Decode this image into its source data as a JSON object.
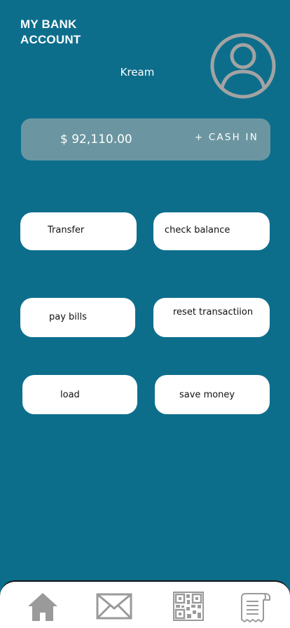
{
  "header": {
    "title": "MY BANK ACCOUNT",
    "user_name": "Kream"
  },
  "balance": {
    "amount": "$ 92,110.00",
    "cash_in_label": "+ CASH IN"
  },
  "actions": {
    "transfer": "Transfer",
    "check_balance": "check balance",
    "pay_bills": "pay bills",
    "reset_transaction": "reset transactiion",
    "load": "load",
    "save_money": "save money"
  },
  "nav": {
    "items": [
      {
        "icon": "home-icon"
      },
      {
        "icon": "mail-icon"
      },
      {
        "icon": "qr-code-icon"
      },
      {
        "icon": "receipt-icon"
      }
    ]
  },
  "colors": {
    "background": "#0d6e8c",
    "card": "#6b96a1",
    "button": "#ffffff",
    "icon_gray": "#9a9a9a"
  }
}
